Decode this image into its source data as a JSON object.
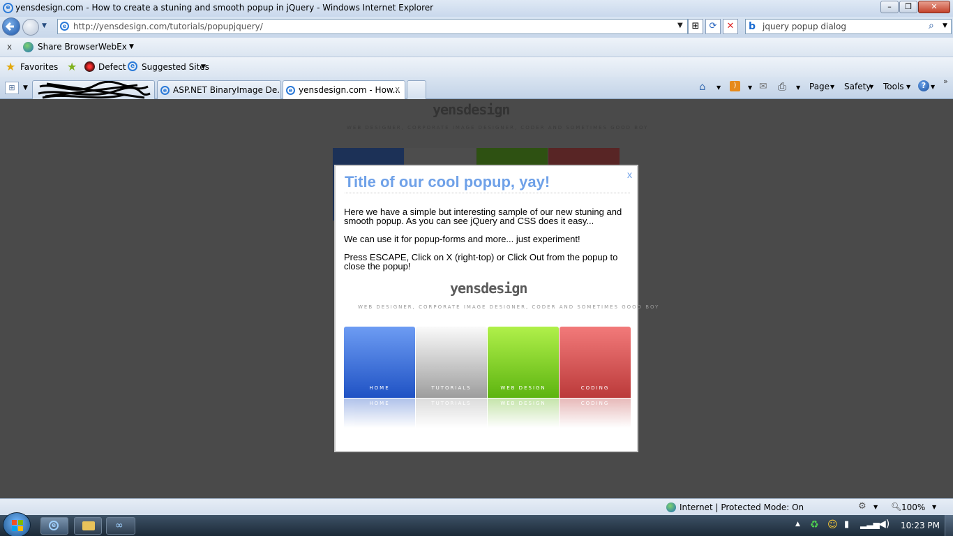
{
  "window": {
    "title": "yensdesign.com - How to create a stuning and smooth popup in jQuery - Windows Internet Explorer",
    "minimize": "–",
    "maximize": "❐",
    "close": "✕"
  },
  "address": {
    "url": "http://yensdesign.com/tutorials/popupjquery/",
    "search_query": "jquery popup dialog"
  },
  "linkbar": {
    "close_glyph": "x",
    "share_browser": "Share Browser",
    "webex": "WebEx"
  },
  "favbar": {
    "favorites": "Favorites",
    "defect": "Defect",
    "suggested_sites": "Suggested Sites"
  },
  "tabs": [
    {
      "label": "ASP.NET BinaryImage De..."
    },
    {
      "label": "yensdesign.com - How...",
      "close": "x"
    }
  ],
  "commandbar": {
    "page": "Page",
    "safety": "Safety",
    "tools": "Tools"
  },
  "page": {
    "logo": "yensdesign",
    "tagline": "WEB DESIGNER, CORPORATE IMAGE DESIGNER, CODER AND SOMETIMES GOOD BOY"
  },
  "popup": {
    "close": "x",
    "title": "Title of our cool popup, yay!",
    "para1": "Here we have a simple but interesting sample of our new stuning and smooth popup. As you can see jQuery and CSS does it easy...",
    "para2": "We can use it for popup-forms and more... just experiment!",
    "para3": "Press ESCAPE, Click on X (right-top) or Click Out from the popup to close the popup!",
    "logo": "yensdesign",
    "tagline": "WEB DESIGNER, CORPORATE IMAGE DESIGNER, CODER AND SOMETIMES GOOD BOY",
    "nav": [
      {
        "label": "HOME",
        "color": "#2f62c9"
      },
      {
        "label": "TUTORIALS",
        "color": "#a9a9a9"
      },
      {
        "label": "WEB DESIGN",
        "color": "#73c81c"
      },
      {
        "label": "CODING",
        "color": "#c94848"
      }
    ]
  },
  "status": {
    "zone": "Internet | Protected Mode: On",
    "zoom": "100%"
  },
  "taskbar": {
    "clock": "10:23 PM"
  }
}
